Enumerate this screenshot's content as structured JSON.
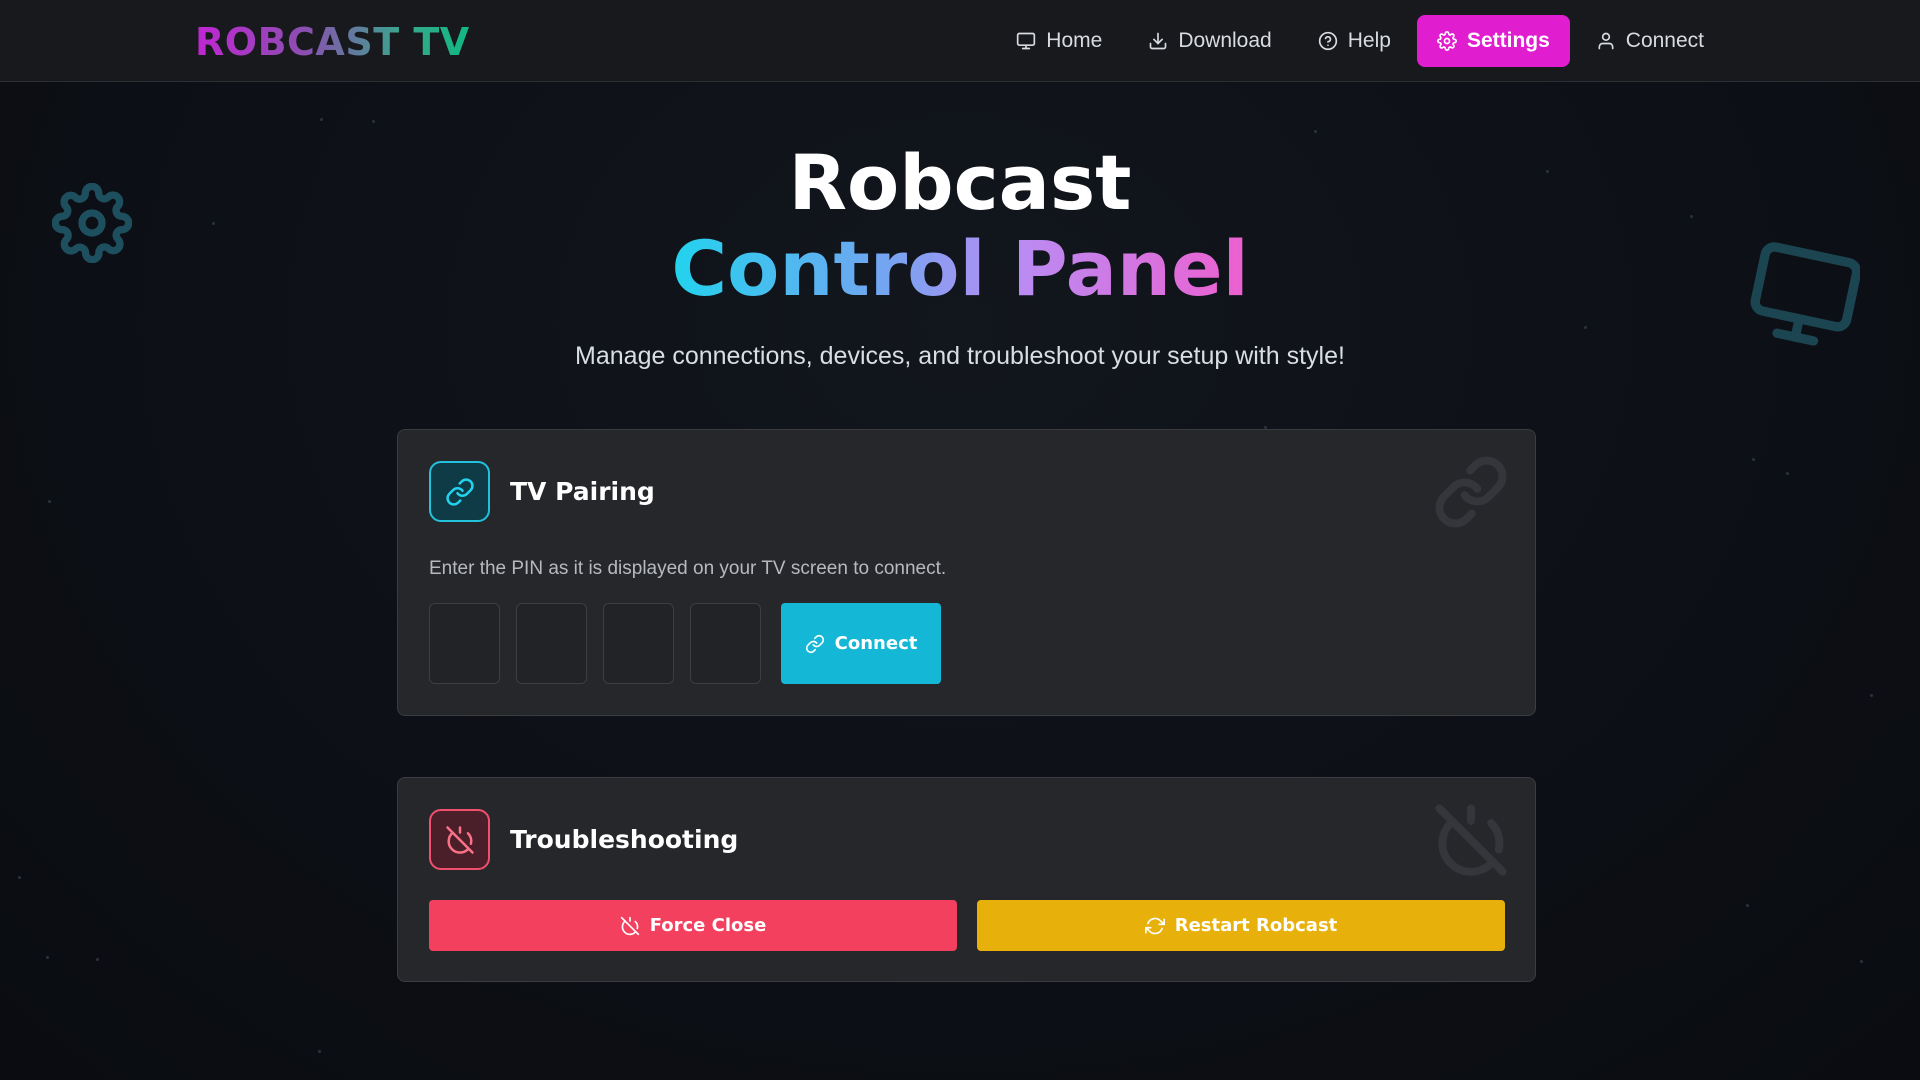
{
  "brand": {
    "logo": "ROBCAST TV"
  },
  "nav": {
    "items": [
      {
        "label": "Home",
        "icon": "monitor-icon"
      },
      {
        "label": "Download",
        "icon": "download-icon"
      },
      {
        "label": "Help",
        "icon": "help-circle-icon"
      },
      {
        "label": "Settings",
        "icon": "gear-icon",
        "active": true
      },
      {
        "label": "Connect",
        "icon": "user-icon"
      }
    ]
  },
  "hero": {
    "title_line1": "Robcast",
    "title_line2": "Control Panel",
    "subtitle": "Manage connections, devices, and troubleshoot your setup with style!"
  },
  "pairing": {
    "title": "TV Pairing",
    "icon": "link-icon",
    "description": "Enter the PIN as it is displayed on your TV screen to connect.",
    "pin_values": [
      "",
      "",
      "",
      ""
    ],
    "connect_label": "Connect"
  },
  "troubleshooting": {
    "title": "Troubleshooting",
    "icon": "power-off-icon",
    "force_close_label": "Force Close",
    "restart_label": "Restart Robcast"
  },
  "colors": {
    "accent_magenta": "#e11ecf",
    "accent_cyan": "#14b7d6",
    "danger": "#f2405e",
    "warning": "#e8b00a",
    "card_bg": "#26272b",
    "page_bg": "#0d1016"
  }
}
